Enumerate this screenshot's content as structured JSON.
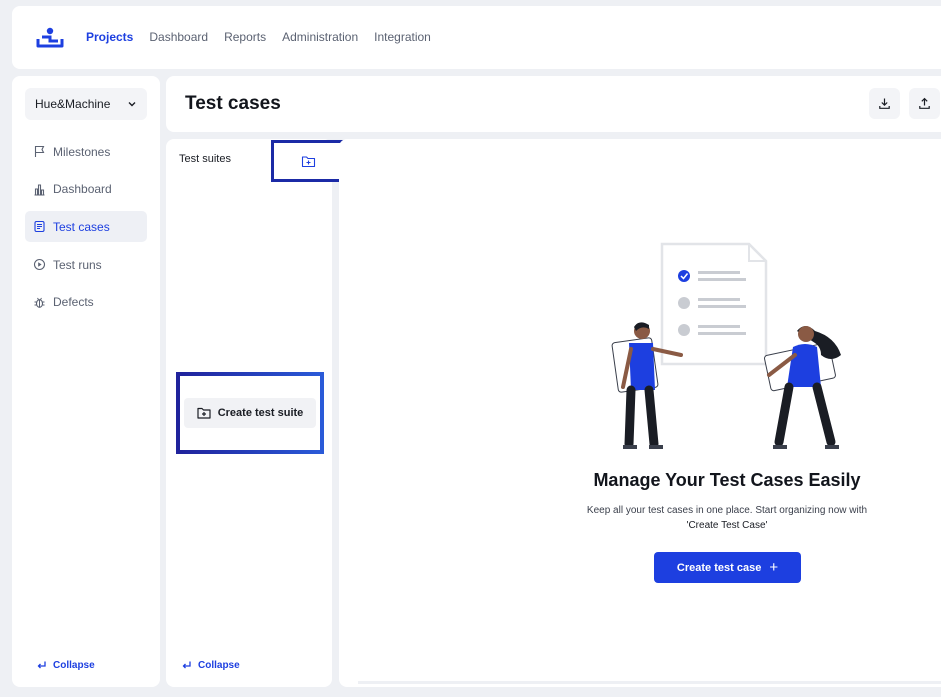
{
  "topbar": {
    "nav": [
      "Projects",
      "Dashboard",
      "Reports",
      "Administration",
      "Integration"
    ]
  },
  "sidebar": {
    "project_name": "Hue&Machine",
    "items": [
      {
        "label": "Milestones",
        "icon": "flag-icon"
      },
      {
        "label": "Dashboard",
        "icon": "bar-chart-icon"
      },
      {
        "label": "Test cases",
        "icon": "document-icon"
      },
      {
        "label": "Test runs",
        "icon": "play-circle-icon"
      },
      {
        "label": "Defects",
        "icon": "bug-icon"
      }
    ],
    "active_item": "Test cases",
    "collapse_label": "Collapse"
  },
  "header": {
    "title": "Test cases",
    "actions": [
      "download-icon",
      "upload-icon"
    ]
  },
  "suites": {
    "title": "Test suites",
    "create_label": "Create test suite",
    "collapse_label": "Collapse"
  },
  "empty_state": {
    "title": "Manage Your Test Cases Easily",
    "description_line1": "Keep all your test cases in one place. Start organizing now with",
    "description_line2": "'Create Test Case'",
    "button_label": "Create test case",
    "button_icon": "+"
  },
  "colors": {
    "accent": "#1d3fe0",
    "highlight_border": "#1b2aa6",
    "background": "#eef0f4"
  }
}
